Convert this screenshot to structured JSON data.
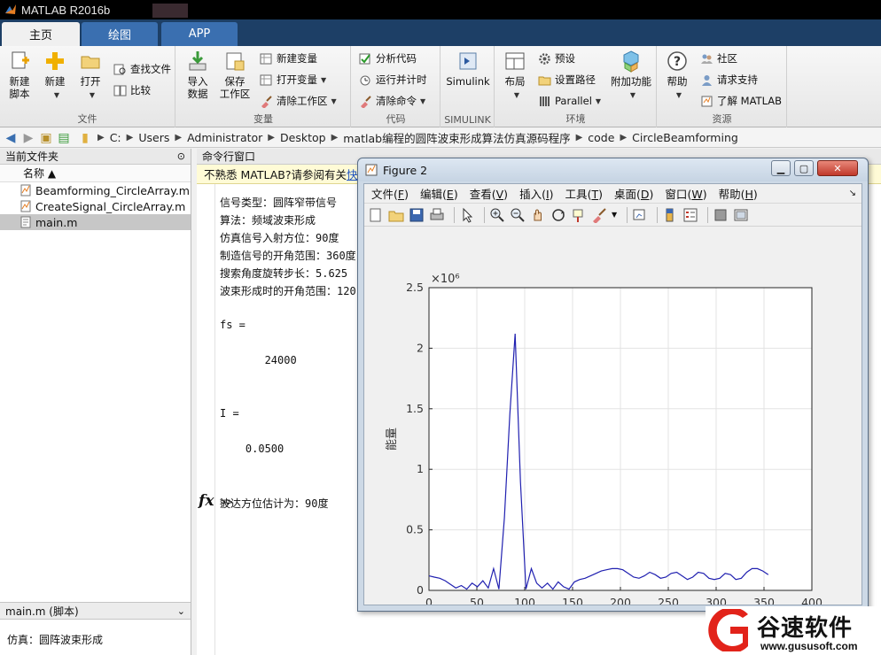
{
  "app": {
    "title": "MATLAB R2016b"
  },
  "tabs": [
    {
      "label": "主页",
      "active": true
    },
    {
      "label": "绘图",
      "active": false
    },
    {
      "label": "APP",
      "active": false
    }
  ],
  "ribbon": {
    "file": {
      "label": "文件",
      "new_script": "新建\n脚本",
      "new": "新建",
      "open": "打开",
      "find_files": "查找文件",
      "compare": "比较"
    },
    "variable": {
      "label": "变量",
      "import": "导入\n数据",
      "save_ws": "保存\n工作区",
      "new_var": "新建变量",
      "open_var": "打开变量",
      "clear_ws": "清除工作区"
    },
    "code": {
      "label": "代码",
      "analyze": "分析代码",
      "run_time": "运行并计时",
      "clear_cmd": "清除命令"
    },
    "simulink": {
      "label": "SIMULINK",
      "simulink": "Simulink"
    },
    "env": {
      "label": "环境",
      "layout": "布局",
      "prefs": "预设",
      "set_path": "设置路径",
      "parallel": "Parallel",
      "addons": "附加功能"
    },
    "resources": {
      "label": "资源",
      "help": "帮助",
      "community": "社区",
      "support": "请求支持",
      "learn": "了解 MATLAB"
    }
  },
  "address": [
    "C:",
    "Users",
    "Administrator",
    "Desktop",
    "matlab编程的圆阵波束形成算法仿真源码程序",
    "code",
    "CircleBeamforming"
  ],
  "left_panel": {
    "title": "当前文件夹",
    "col_name": "名称 ▲",
    "files": [
      {
        "name": "Beamforming_CircleArray.m",
        "selected": false
      },
      {
        "name": "CreateSignal_CircleArray.m",
        "selected": false
      },
      {
        "name": "main.m",
        "selected": true
      }
    ],
    "detail_title": "main.m  (脚本)",
    "detail_text": "仿真：圆阵波束形成"
  },
  "command": {
    "title": "命令行窗口",
    "notice": "不熟悉 MATLAB?请参阅有关",
    "notice_link": "快速",
    "lines": [
      "信号类型：圆阵窄带信号",
      "算法：频域波束形成",
      "仿真信号入射方位：90度",
      "制造信号的开角范围：360度",
      "搜索角度旋转步长：5.625",
      "波束形成时的开角范围：120",
      "",
      "fs =",
      "",
      "       24000",
      "",
      "",
      "I =",
      "",
      "    0.0500",
      "",
      "",
      "波达方位估计为：90度"
    ],
    "fx": "fx",
    "prompt": ">>"
  },
  "figure": {
    "title": "Figure 2",
    "menu": [
      {
        "label": "文件",
        "key": "F"
      },
      {
        "label": "编辑",
        "key": "E"
      },
      {
        "label": "查看",
        "key": "V"
      },
      {
        "label": "插入",
        "key": "I"
      },
      {
        "label": "工具",
        "key": "T"
      },
      {
        "label": "桌面",
        "key": "D"
      },
      {
        "label": "窗口",
        "key": "W"
      },
      {
        "label": "帮助",
        "key": "H"
      }
    ]
  },
  "chart_data": {
    "type": "line",
    "title": "",
    "xlabel": "方位/度",
    "ylabel": "能量",
    "y_exponent": "×10⁶",
    "xlim": [
      0,
      400
    ],
    "ylim": [
      0,
      2.5
    ],
    "xticks": [
      0,
      50,
      100,
      150,
      200,
      250,
      300,
      350,
      400
    ],
    "yticks": [
      0,
      0.5,
      1,
      1.5,
      2,
      2.5
    ],
    "grid": true,
    "color": "#2020b0",
    "series": [
      {
        "x": [
          0,
          5.6,
          11.3,
          16.9,
          22.5,
          28.1,
          33.8,
          39.4,
          45,
          50.6,
          56.3,
          61.9,
          67.5,
          73.1,
          78.8,
          84.4,
          90,
          95.6,
          101.3,
          106.9,
          112.5,
          118.1,
          123.8,
          129.4,
          135,
          140.6,
          146.3,
          151.9,
          157.5,
          163.1,
          168.8,
          174.4,
          180,
          185.6,
          191.3,
          196.9,
          202.5,
          208.1,
          213.8,
          219.4,
          225,
          230.6,
          236.3,
          241.9,
          247.5,
          253.1,
          258.8,
          264.4,
          270,
          275.6,
          281.3,
          286.9,
          292.5,
          298.1,
          303.8,
          309.4,
          315,
          320.6,
          326.3,
          331.9,
          337.5,
          343.1,
          348.8,
          354.4
        ],
        "y": [
          0.12,
          0.11,
          0.1,
          0.08,
          0.05,
          0.02,
          0.04,
          0.01,
          0.06,
          0.03,
          0.08,
          0.02,
          0.18,
          0.01,
          0.6,
          1.45,
          2.12,
          0.9,
          0.01,
          0.18,
          0.06,
          0.02,
          0.06,
          0.01,
          0.07,
          0.03,
          0.01,
          0.07,
          0.09,
          0.1,
          0.12,
          0.14,
          0.16,
          0.17,
          0.18,
          0.18,
          0.17,
          0.14,
          0.11,
          0.1,
          0.12,
          0.15,
          0.13,
          0.1,
          0.11,
          0.14,
          0.15,
          0.12,
          0.09,
          0.11,
          0.15,
          0.14,
          0.1,
          0.09,
          0.1,
          0.14,
          0.13,
          0.09,
          0.1,
          0.15,
          0.18,
          0.18,
          0.16,
          0.13
        ]
      }
    ]
  },
  "watermark": {
    "text": "谷速软件",
    "url": "www.gususoft.com"
  }
}
